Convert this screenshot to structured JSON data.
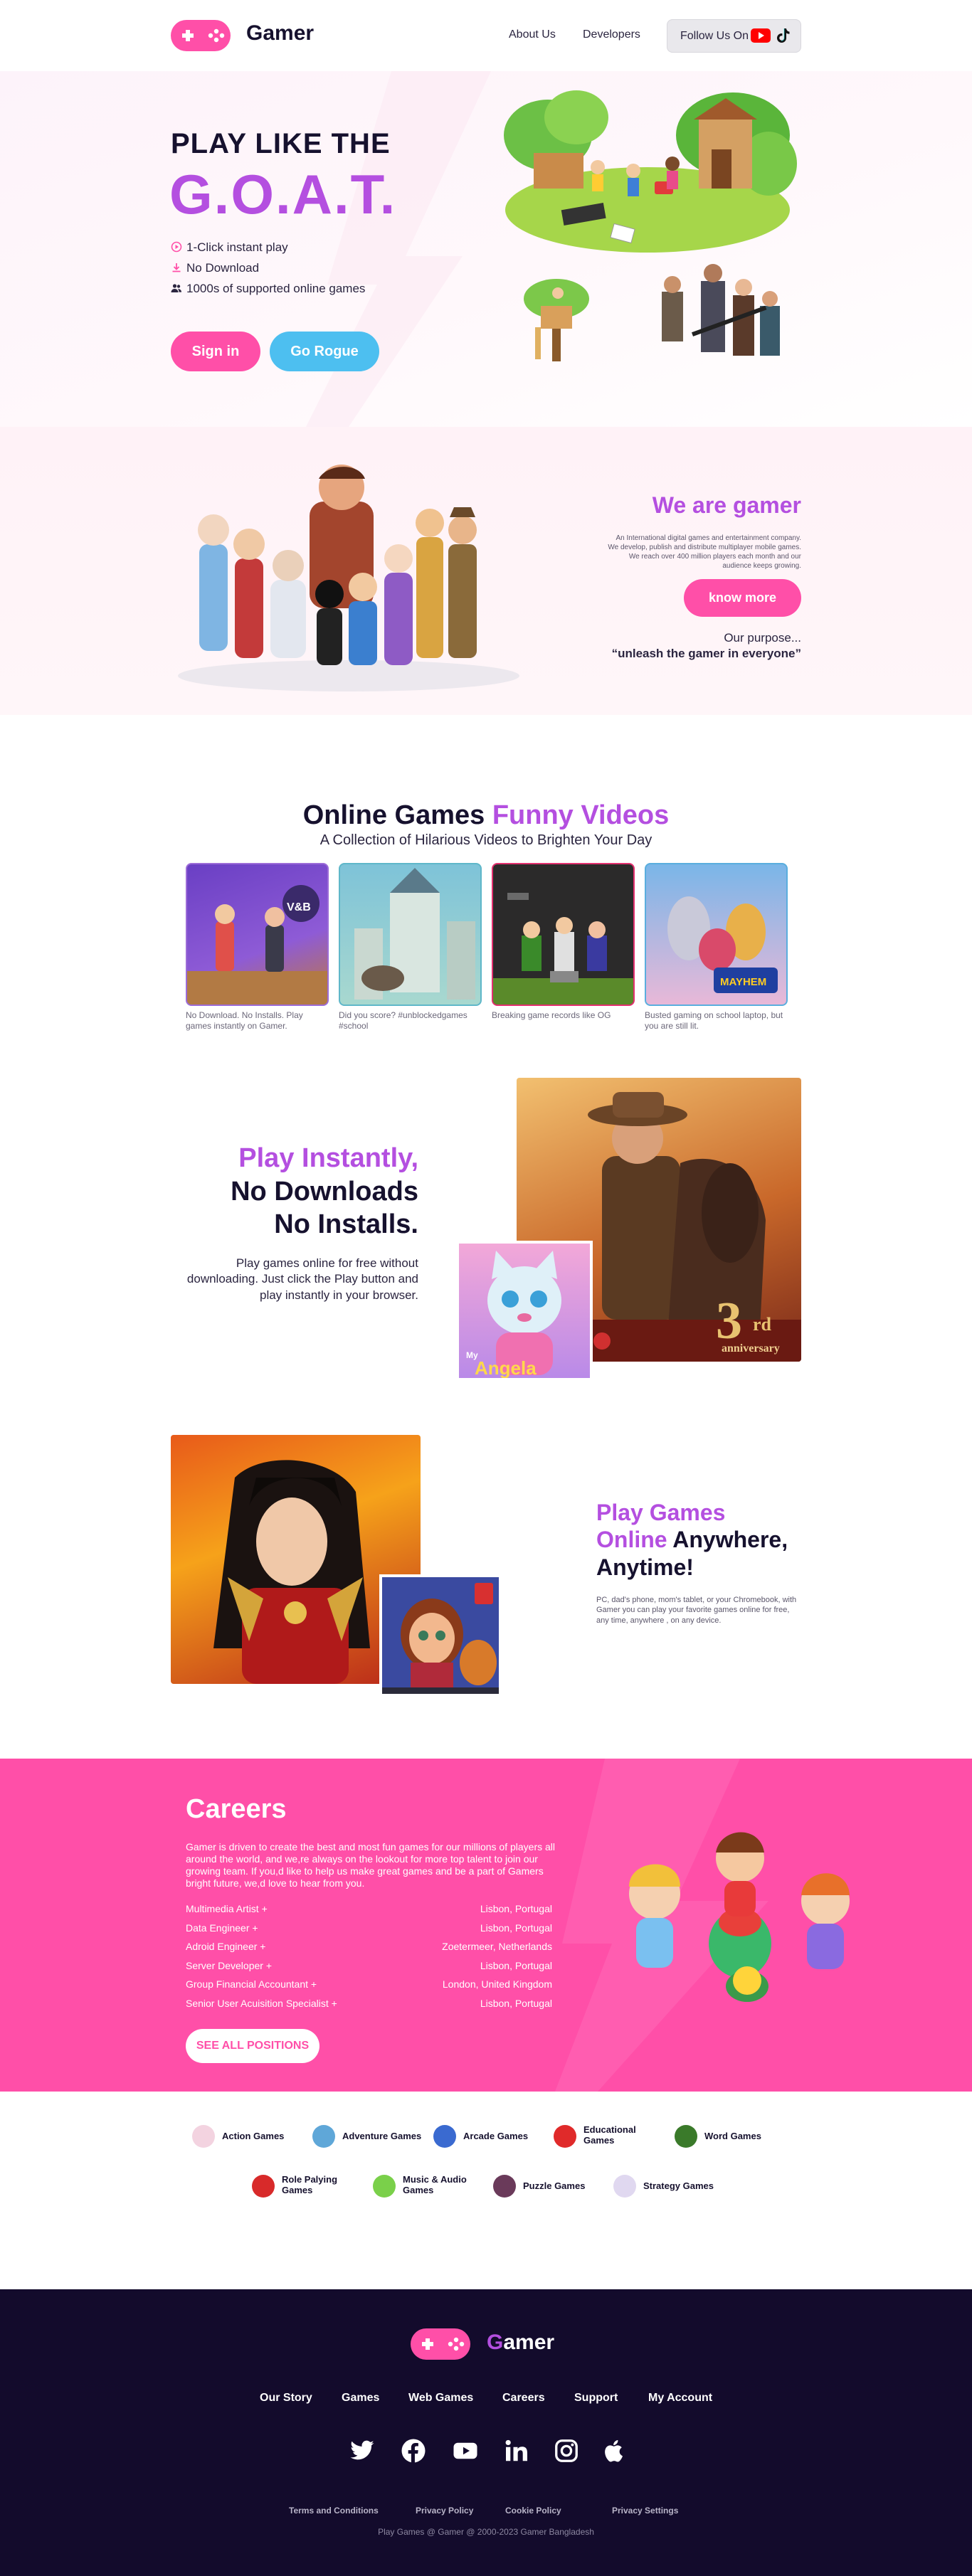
{
  "brand": {
    "name": "Gamer",
    "footer_name_first": "G",
    "footer_name_rest": "amer",
    "pink": "#ff4fa8",
    "purple": "#b44fe0",
    "navy": "#130b2c",
    "blue": "#4dbff0"
  },
  "nav": {
    "about": "About Us",
    "developers": "Developers",
    "follow": "Follow Us On"
  },
  "hero": {
    "title_line1": "PLAY LIKE THE",
    "title_line2": "G.O.A.T.",
    "features": [
      "1-Click instant play",
      "No Download",
      "1000s of supported online games"
    ],
    "signin": "Sign in",
    "rogue": "Go Rogue"
  },
  "about": {
    "title": "We are gamer",
    "text": "An International digital games and entertainment company. We develop, publish and distribute multiplayer mobile games. We reach over 400 million players each month and our audience keeps growing.",
    "button": "know more",
    "purpose_label": "Our purpose...",
    "purpose": "“unleash the gamer in everyone”"
  },
  "videos": {
    "title_a": "Online Games ",
    "title_b": "Funny Videos",
    "subtitle": "A Collection of Hilarious Videos to Brighten Your Day",
    "items": [
      {
        "caption": "No Download. No Installs. Play games instantly on Gamer."
      },
      {
        "caption": "Did you score? #unblockedgames #school"
      },
      {
        "caption": "Breaking game records like OG"
      },
      {
        "caption": "Busted gaming on school laptop, but you are still lit."
      }
    ]
  },
  "instant": {
    "line1": "Play Instantly,",
    "line2": "No Downloads",
    "line3": "No Installs.",
    "text": "Play games online for free without downloading. Just click the Play button and play instantly in your browser.",
    "anniv_num": "3",
    "anniv_suffix": "rd",
    "anniv_word": "anniversary",
    "card_small": "My",
    "card_title": "Angela"
  },
  "anywhere": {
    "p1": "Play Games",
    "p2": "Online",
    "p3": " Anywhere,",
    "p4": "Anytime!",
    "text": "PC, dad's phone, mom's tablet, or your Chromebook, with Gamer you can play your favorite games online for free, any time, anywhere , on any device."
  },
  "careers": {
    "title": "Careers",
    "text": "Gamer is driven to create the best and most fun games for our millions of players all around the world, and we,re always on the lookout for more top talent to join our growing team. If you,d like to help us make great games and be a part of Gamers bright future, we,d love to hear from you.",
    "jobs": [
      {
        "title": "Multimedia Artist +",
        "location": "Lisbon, Portugal"
      },
      {
        "title": "Data Engineer +",
        "location": "Lisbon, Portugal"
      },
      {
        "title": "Adroid Engineer +",
        "location": "Zoetermeer, Netherlands"
      },
      {
        "title": "Server Developer +",
        "location": "Lisbon, Portugal"
      },
      {
        "title": "Group Financial Accountant +",
        "location": "London, United Kingdom"
      },
      {
        "title": "Senior User Acuisition Specialist +",
        "location": "Lisbon, Portugal"
      }
    ],
    "button": "SEE ALL POSITIONS"
  },
  "categories": [
    {
      "label": "Action Games"
    },
    {
      "label": "Adventure Games"
    },
    {
      "label": "Arcade Games"
    },
    {
      "label": "Educational Games"
    },
    {
      "label": "Word Games"
    },
    {
      "label": "Role Palying Games"
    },
    {
      "label": "Music & Audio Games"
    },
    {
      "label": "Puzzle Games"
    },
    {
      "label": "Strategy Games"
    }
  ],
  "footer": {
    "links": [
      "Our Story",
      "Games",
      "Web Games",
      "Careers",
      "Support",
      "My Account"
    ],
    "social": [
      "twitter-icon",
      "facebook-icon",
      "youtube-icon",
      "linkedin-icon",
      "instagram-icon",
      "apple-icon"
    ],
    "small_links": [
      "Terms and Conditions",
      "Privacy Policy",
      "Cookie Policy",
      "Privacy Settings"
    ],
    "copyright": "Play Games @ Gamer @ 2000-2023 Gamer Bangladesh"
  }
}
